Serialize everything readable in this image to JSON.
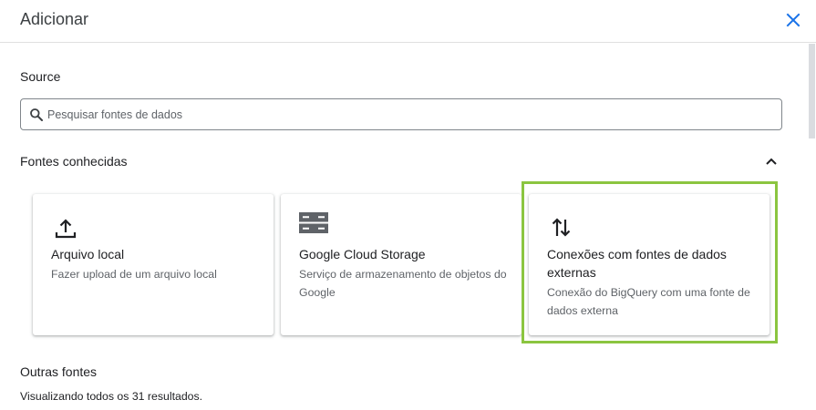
{
  "dialog": {
    "title": "Adicionar",
    "close_icon": "close-icon"
  },
  "source": {
    "label": "Source",
    "search_placeholder": "Pesquisar fontes de dados",
    "search_value": ""
  },
  "known_sources": {
    "heading": "Fontes conhecidas",
    "collapse_icon": "chevron-up-icon",
    "cards": [
      {
        "icon": "upload-icon",
        "title": "Arquivo local",
        "description": "Fazer upload de um arquivo local"
      },
      {
        "icon": "storage-icon",
        "title": "Google Cloud Storage",
        "description": "Serviço de armazenamento de objetos do Google"
      },
      {
        "icon": "swap-vertical-icon",
        "title": "Conexões com fontes de dados externas",
        "description": "Conexão do BigQuery com uma fonte de dados externa",
        "highlighted": true
      }
    ]
  },
  "other_sources": {
    "heading": "Outras fontes",
    "results_text": "Visualizando todos os 31 resultados."
  },
  "colors": {
    "accent": "#1a73e8",
    "highlight_border": "#8bc540",
    "icon_dark": "#202124",
    "storage_icon": "#5f6368"
  }
}
